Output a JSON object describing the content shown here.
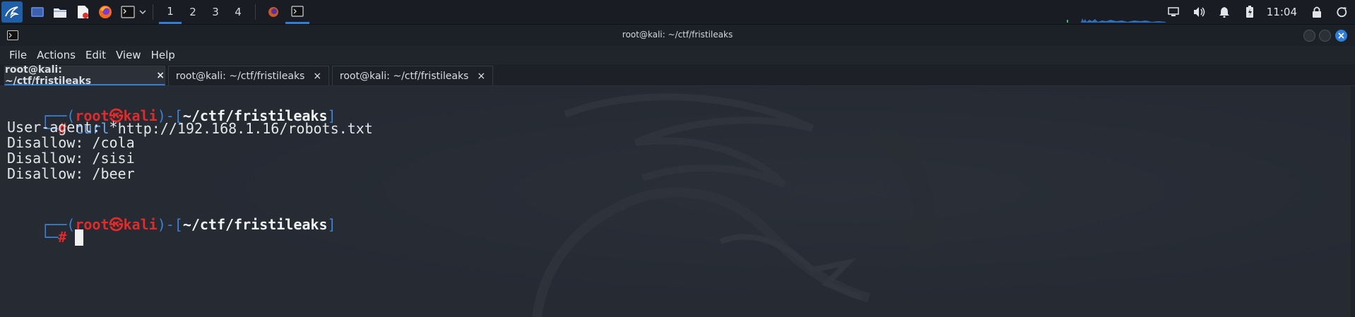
{
  "panel": {
    "workspaces": [
      "1",
      "2",
      "3",
      "4"
    ],
    "active_workspace": "1",
    "clock": "11:04",
    "quick_launch_icons": [
      "desktop-icon",
      "file-manager-icon",
      "text-editor-icon",
      "firefox-icon",
      "terminal-icon",
      "chevron-down-icon"
    ],
    "tray_icons": [
      "display-icon",
      "volume-icon",
      "notification-bell-icon",
      "battery-icon",
      "lock-icon",
      "power-icon"
    ]
  },
  "window": {
    "title": "root@kali: ~/ctf/fristileaks"
  },
  "menubar": {
    "items": [
      "File",
      "Actions",
      "Edit",
      "View",
      "Help"
    ]
  },
  "tabs": [
    {
      "label": "root@kali: ~/ctf/fristileaks",
      "close": "×"
    },
    {
      "label": "root@kali: ~/ctf/fristileaks",
      "close": "×"
    },
    {
      "label": "root@kali: ~/ctf/fristileaks",
      "close": "×"
    }
  ],
  "terminal": {
    "prompt1": {
      "user": "root",
      "host": "kali",
      "path": "~/ctf/fristileaks",
      "symbol": "#",
      "command_name": "curl",
      "command_args": " http://192.168.1.16/robots.txt"
    },
    "output": [
      "User-agent: *",
      "Disallow: /cola",
      "Disallow: /sisi",
      "Disallow: /beer"
    ],
    "prompt2": {
      "user": "root",
      "host": "kali",
      "path": "~/ctf/fristileaks",
      "symbol": "#"
    }
  },
  "colors": {
    "accent": "#2f7fd8",
    "prompt_red": "#e22a2a",
    "prompt_blue": "#3b82d6",
    "background": "#252a33"
  }
}
